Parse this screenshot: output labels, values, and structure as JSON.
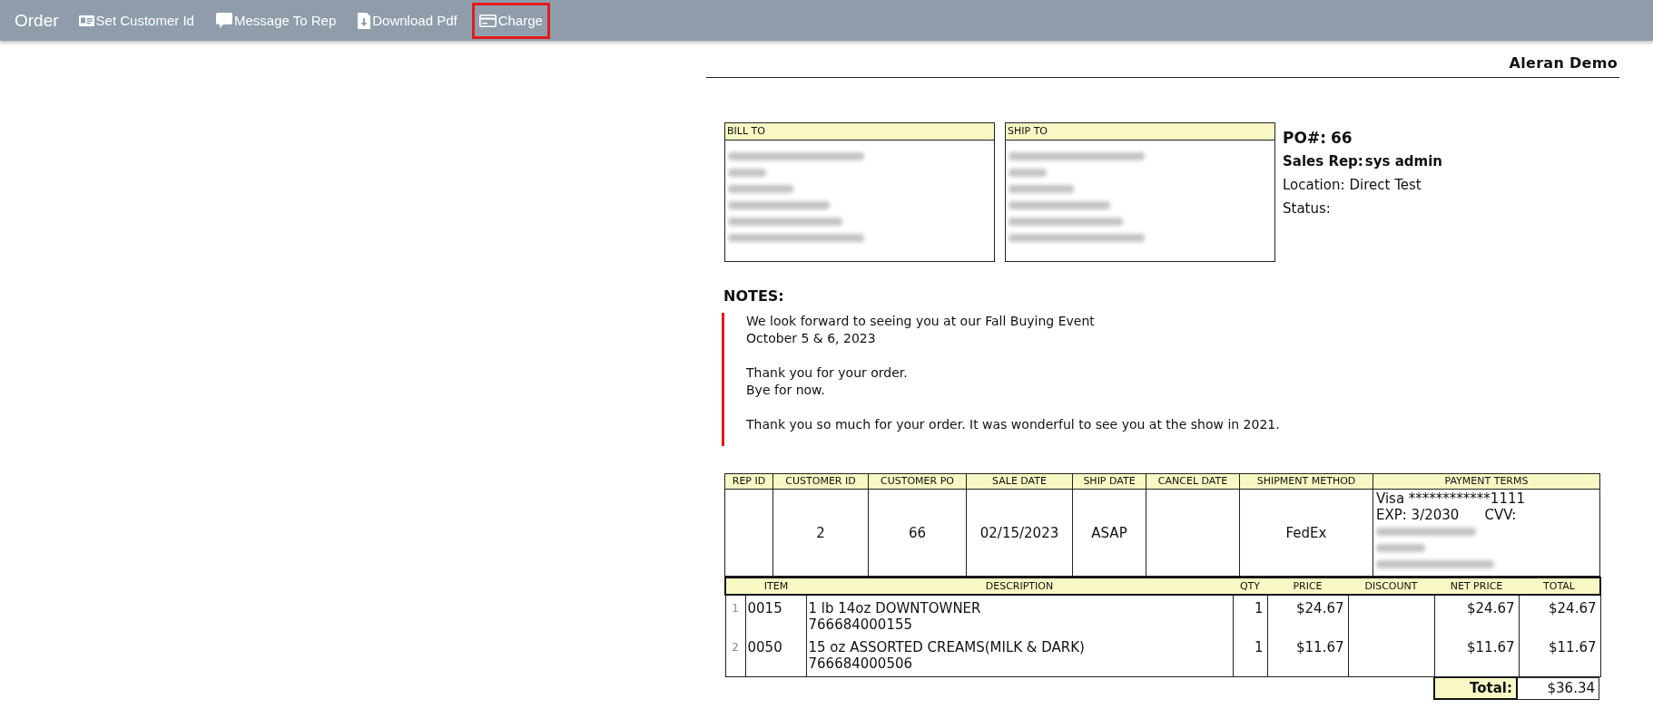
{
  "toolbar": {
    "title": "Order",
    "actions": [
      {
        "kind": "id-card",
        "label": "Set Customer Id",
        "highlighted": false
      },
      {
        "kind": "message",
        "label": "Message To Rep",
        "highlighted": false
      },
      {
        "kind": "download",
        "label": "Download Pdf",
        "highlighted": false
      },
      {
        "kind": "card",
        "label": "Charge",
        "highlighted": true
      }
    ]
  },
  "header": {
    "company": "Aleran Demo"
  },
  "addresses": [
    {
      "title": "BILL TO"
    },
    {
      "title": "SHIP TO"
    }
  ],
  "order_summary": [
    {
      "kind": "large",
      "label": "PO#:",
      "value": "66"
    },
    {
      "kind": "bold",
      "label": "Sales Rep:",
      "value": "sys admin"
    },
    {
      "kind": "plain",
      "label": "Location:",
      "value": "Direct Test"
    },
    {
      "kind": "plain",
      "label": "Status:"
    }
  ],
  "notes": {
    "title": "NOTES:",
    "paragraphs": [
      {
        "lines": [
          "We look forward to seeing you at our Fall Buying Event",
          "October 5 & 6, 2023"
        ]
      },
      {
        "lines": [
          "Thank you for your order.",
          "Bye for now."
        ]
      },
      {
        "lines": [
          "Thank you so much for your order. It was wonderful to see you at the show in 2021."
        ]
      }
    ]
  },
  "order_info": {
    "columns": [
      {
        "kind": "text",
        "header": "REP ID"
      },
      {
        "kind": "text",
        "header": "CUSTOMER ID",
        "value": "2"
      },
      {
        "kind": "text",
        "header": "CUSTOMER PO",
        "value": "66"
      },
      {
        "kind": "text",
        "header": "SALE DATE",
        "value": "02/15/2023"
      },
      {
        "kind": "text",
        "header": "SHIP DATE",
        "value": "ASAP"
      },
      {
        "kind": "text",
        "header": "CANCEL DATE"
      },
      {
        "kind": "text",
        "header": "SHIPMENT METHOD",
        "value": "FedEx"
      },
      {
        "kind": "payment",
        "header": "PAYMENT TERMS"
      }
    ],
    "payment": {
      "card": "Visa ************1111",
      "expiry": "EXP: 3/2030",
      "cvv_label": "CVV:"
    }
  },
  "items": {
    "columns": [
      "ITEM",
      "DESCRIPTION",
      "QTY",
      "PRICE",
      "DISCOUNT",
      "NET PRICE",
      "TOTAL"
    ],
    "rows": [
      {
        "line": "1",
        "item": "0015",
        "description": "1 lb 14oz DOWNTOWNER",
        "upc": "766684000155",
        "qty": "1",
        "price": "$24.67",
        "net_price": "$24.67",
        "total": "$24.67"
      },
      {
        "line": "2",
        "item": "0050",
        "description": "15 oz ASSORTED CREAMS(MILK & DARK)",
        "upc": "766684000506",
        "qty": "1",
        "price": "$11.67",
        "net_price": "$11.67",
        "total": "$11.67"
      }
    ],
    "total_label": "Total:",
    "total_value": "$36.34"
  }
}
